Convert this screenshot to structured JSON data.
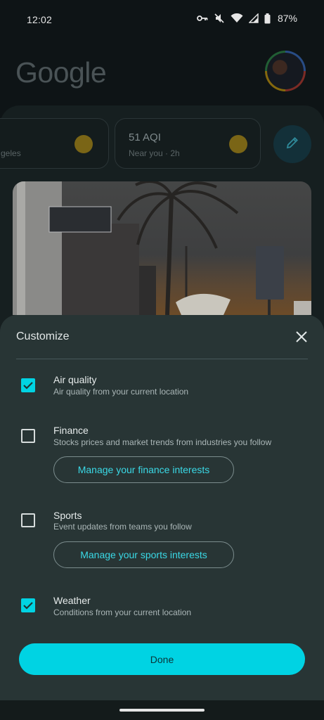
{
  "status_bar": {
    "time": "12:02",
    "battery": "87%",
    "icons": [
      "vpn-key-icon",
      "mute-icon",
      "wifi-icon",
      "signal-icon",
      "battery-icon"
    ]
  },
  "header": {
    "logo_text": "Google",
    "avatar": "profile-avatar"
  },
  "feed": {
    "cards": [
      {
        "title": "",
        "subtitle": "geles"
      },
      {
        "title": "51 AQI",
        "subtitle": "Near you · 2h"
      }
    ],
    "edit_icon": "pencil-icon"
  },
  "sheet": {
    "title": "Customize",
    "close_icon": "close-icon",
    "options": [
      {
        "title": "Air quality",
        "description": "Air quality from your current location",
        "checked": true
      },
      {
        "title": "Finance",
        "description": "Stocks prices and market trends from industries you follow",
        "checked": false,
        "manage_label": "Manage your finance interests"
      },
      {
        "title": "Sports",
        "description": "Event updates from teams you follow",
        "checked": false,
        "manage_label": "Manage your sports interests"
      },
      {
        "title": "Weather",
        "description": "Conditions from your current location",
        "checked": true
      }
    ],
    "done_label": "Done"
  },
  "colors": {
    "accent": "#00d3e3",
    "sheet_bg": "#283535",
    "background": "#0e1416"
  }
}
